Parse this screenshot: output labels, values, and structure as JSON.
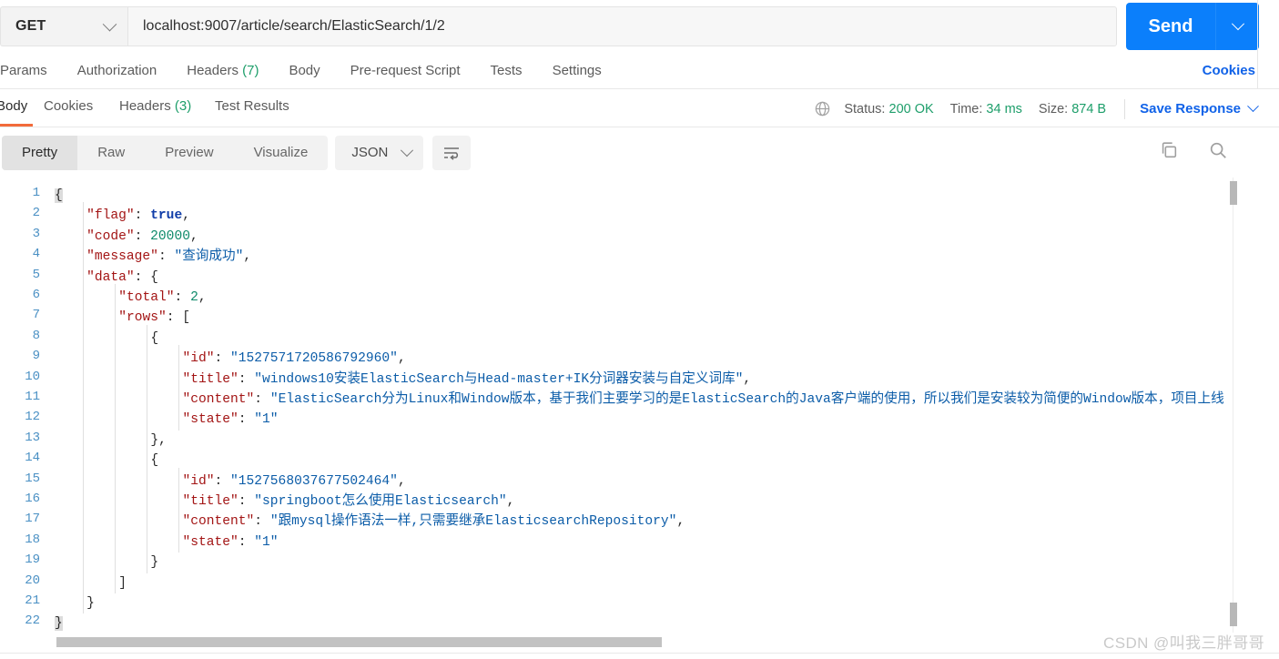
{
  "request": {
    "method": "GET",
    "url": "localhost:9007/article/search/ElasticSearch/1/2",
    "send_label": "Send",
    "send_caret_icon": "chevron-down-icon",
    "method_caret_icon": "chevron-down-icon",
    "tabs": [
      {
        "label": "Params",
        "count": ""
      },
      {
        "label": "Authorization",
        "count": ""
      },
      {
        "label": "Headers",
        "count": "(7)"
      },
      {
        "label": "Body",
        "count": ""
      },
      {
        "label": "Pre-request Script",
        "count": ""
      },
      {
        "label": "Tests",
        "count": ""
      },
      {
        "label": "Settings",
        "count": ""
      }
    ],
    "cookies_link": "Cookies"
  },
  "response": {
    "tabs": [
      {
        "label": "Body",
        "count": "",
        "active": true
      },
      {
        "label": "Cookies",
        "count": "",
        "active": false
      },
      {
        "label": "Headers",
        "count": "(3)",
        "active": false
      },
      {
        "label": "Test Results",
        "count": "",
        "active": false
      }
    ],
    "globe_icon": "globe-icon",
    "status_label": "Status:",
    "status_value": "200 OK",
    "time_label": "Time:",
    "time_value": "34 ms",
    "size_label": "Size:",
    "size_value": "874 B",
    "save_response": "Save Response",
    "save_response_caret_icon": "chevron-down-icon",
    "view_modes": [
      {
        "label": "Pretty",
        "active": true
      },
      {
        "label": "Raw",
        "active": false
      },
      {
        "label": "Preview",
        "active": false
      },
      {
        "label": "Visualize",
        "active": false
      }
    ],
    "format": "JSON",
    "format_caret_icon": "chevron-down-icon",
    "wrap_icon": "word-wrap-icon",
    "copy_icon": "copy-icon",
    "search_icon": "search-icon"
  },
  "body": {
    "language": "json",
    "total_lines": 22,
    "lines": [
      {
        "n": 1,
        "indent": 0,
        "tokens": [
          {
            "t": "{",
            "c": "p brhl"
          }
        ]
      },
      {
        "n": 2,
        "indent": 1,
        "tokens": [
          {
            "t": "\"flag\"",
            "c": "k"
          },
          {
            "t": ": ",
            "c": "p"
          },
          {
            "t": "true",
            "c": "bo"
          },
          {
            "t": ",",
            "c": "p"
          }
        ]
      },
      {
        "n": 3,
        "indent": 1,
        "tokens": [
          {
            "t": "\"code\"",
            "c": "k"
          },
          {
            "t": ": ",
            "c": "p"
          },
          {
            "t": "20000",
            "c": "n"
          },
          {
            "t": ",",
            "c": "p"
          }
        ]
      },
      {
        "n": 4,
        "indent": 1,
        "tokens": [
          {
            "t": "\"message\"",
            "c": "k"
          },
          {
            "t": ": ",
            "c": "p"
          },
          {
            "t": "\"查询成功\"",
            "c": "s"
          },
          {
            "t": ",",
            "c": "p"
          }
        ]
      },
      {
        "n": 5,
        "indent": 1,
        "tokens": [
          {
            "t": "\"data\"",
            "c": "k"
          },
          {
            "t": ": {",
            "c": "p"
          }
        ]
      },
      {
        "n": 6,
        "indent": 2,
        "tokens": [
          {
            "t": "\"total\"",
            "c": "k"
          },
          {
            "t": ": ",
            "c": "p"
          },
          {
            "t": "2",
            "c": "n"
          },
          {
            "t": ",",
            "c": "p"
          }
        ]
      },
      {
        "n": 7,
        "indent": 2,
        "tokens": [
          {
            "t": "\"rows\"",
            "c": "k"
          },
          {
            "t": ": [",
            "c": "p"
          }
        ]
      },
      {
        "n": 8,
        "indent": 3,
        "tokens": [
          {
            "t": "{",
            "c": "p"
          }
        ]
      },
      {
        "n": 9,
        "indent": 4,
        "tokens": [
          {
            "t": "\"id\"",
            "c": "k"
          },
          {
            "t": ": ",
            "c": "p"
          },
          {
            "t": "\"1527571720586792960\"",
            "c": "s"
          },
          {
            "t": ",",
            "c": "p"
          }
        ]
      },
      {
        "n": 10,
        "indent": 4,
        "tokens": [
          {
            "t": "\"title\"",
            "c": "k"
          },
          {
            "t": ": ",
            "c": "p"
          },
          {
            "t": "\"windows10安装ElasticSearch与Head-master+IK分词器安装与自定义词库\"",
            "c": "s"
          },
          {
            "t": ",",
            "c": "p"
          }
        ]
      },
      {
        "n": 11,
        "indent": 4,
        "tokens": [
          {
            "t": "\"content\"",
            "c": "k"
          },
          {
            "t": ": ",
            "c": "p"
          },
          {
            "t": "\"ElasticSearch分为Linux和Window版本，基于我们主要学习的是ElasticSearch的Java客户端的使用，所以我们是安装较为简便的Window版本，项目上线",
            "c": "s"
          }
        ]
      },
      {
        "n": 12,
        "indent": 4,
        "tokens": [
          {
            "t": "\"state\"",
            "c": "k"
          },
          {
            "t": ": ",
            "c": "p"
          },
          {
            "t": "\"1\"",
            "c": "s"
          }
        ]
      },
      {
        "n": 13,
        "indent": 3,
        "tokens": [
          {
            "t": "},",
            "c": "p"
          }
        ]
      },
      {
        "n": 14,
        "indent": 3,
        "tokens": [
          {
            "t": "{",
            "c": "p"
          }
        ]
      },
      {
        "n": 15,
        "indent": 4,
        "tokens": [
          {
            "t": "\"id\"",
            "c": "k"
          },
          {
            "t": ": ",
            "c": "p"
          },
          {
            "t": "\"1527568037677502464\"",
            "c": "s"
          },
          {
            "t": ",",
            "c": "p"
          }
        ]
      },
      {
        "n": 16,
        "indent": 4,
        "tokens": [
          {
            "t": "\"title\"",
            "c": "k"
          },
          {
            "t": ": ",
            "c": "p"
          },
          {
            "t": "\"springboot怎么使用Elasticsearch\"",
            "c": "s"
          },
          {
            "t": ",",
            "c": "p"
          }
        ]
      },
      {
        "n": 17,
        "indent": 4,
        "tokens": [
          {
            "t": "\"content\"",
            "c": "k"
          },
          {
            "t": ": ",
            "c": "p"
          },
          {
            "t": "\"跟mysql操作语法一样,只需要继承ElasticsearchRepository\"",
            "c": "s"
          },
          {
            "t": ",",
            "c": "p"
          }
        ]
      },
      {
        "n": 18,
        "indent": 4,
        "tokens": [
          {
            "t": "\"state\"",
            "c": "k"
          },
          {
            "t": ": ",
            "c": "p"
          },
          {
            "t": "\"1\"",
            "c": "s"
          }
        ]
      },
      {
        "n": 19,
        "indent": 3,
        "tokens": [
          {
            "t": "}",
            "c": "p"
          }
        ]
      },
      {
        "n": 20,
        "indent": 2,
        "tokens": [
          {
            "t": "]",
            "c": "p"
          }
        ]
      },
      {
        "n": 21,
        "indent": 1,
        "tokens": [
          {
            "t": "}",
            "c": "p"
          }
        ]
      },
      {
        "n": 22,
        "indent": 0,
        "tokens": [
          {
            "t": "}",
            "c": "p brhl"
          }
        ]
      }
    ]
  },
  "watermark": "CSDN @叫我三胖哥哥",
  "colors": {
    "accent_blue": "#0b7ffb",
    "link_blue": "#1062e8",
    "active_underline": "#f26b3a",
    "status_green": "#1d9e6a",
    "json_key": "#a31515",
    "json_string": "#0b5ca8",
    "json_number": "#0f8a6a",
    "json_bool": "#103da8"
  }
}
